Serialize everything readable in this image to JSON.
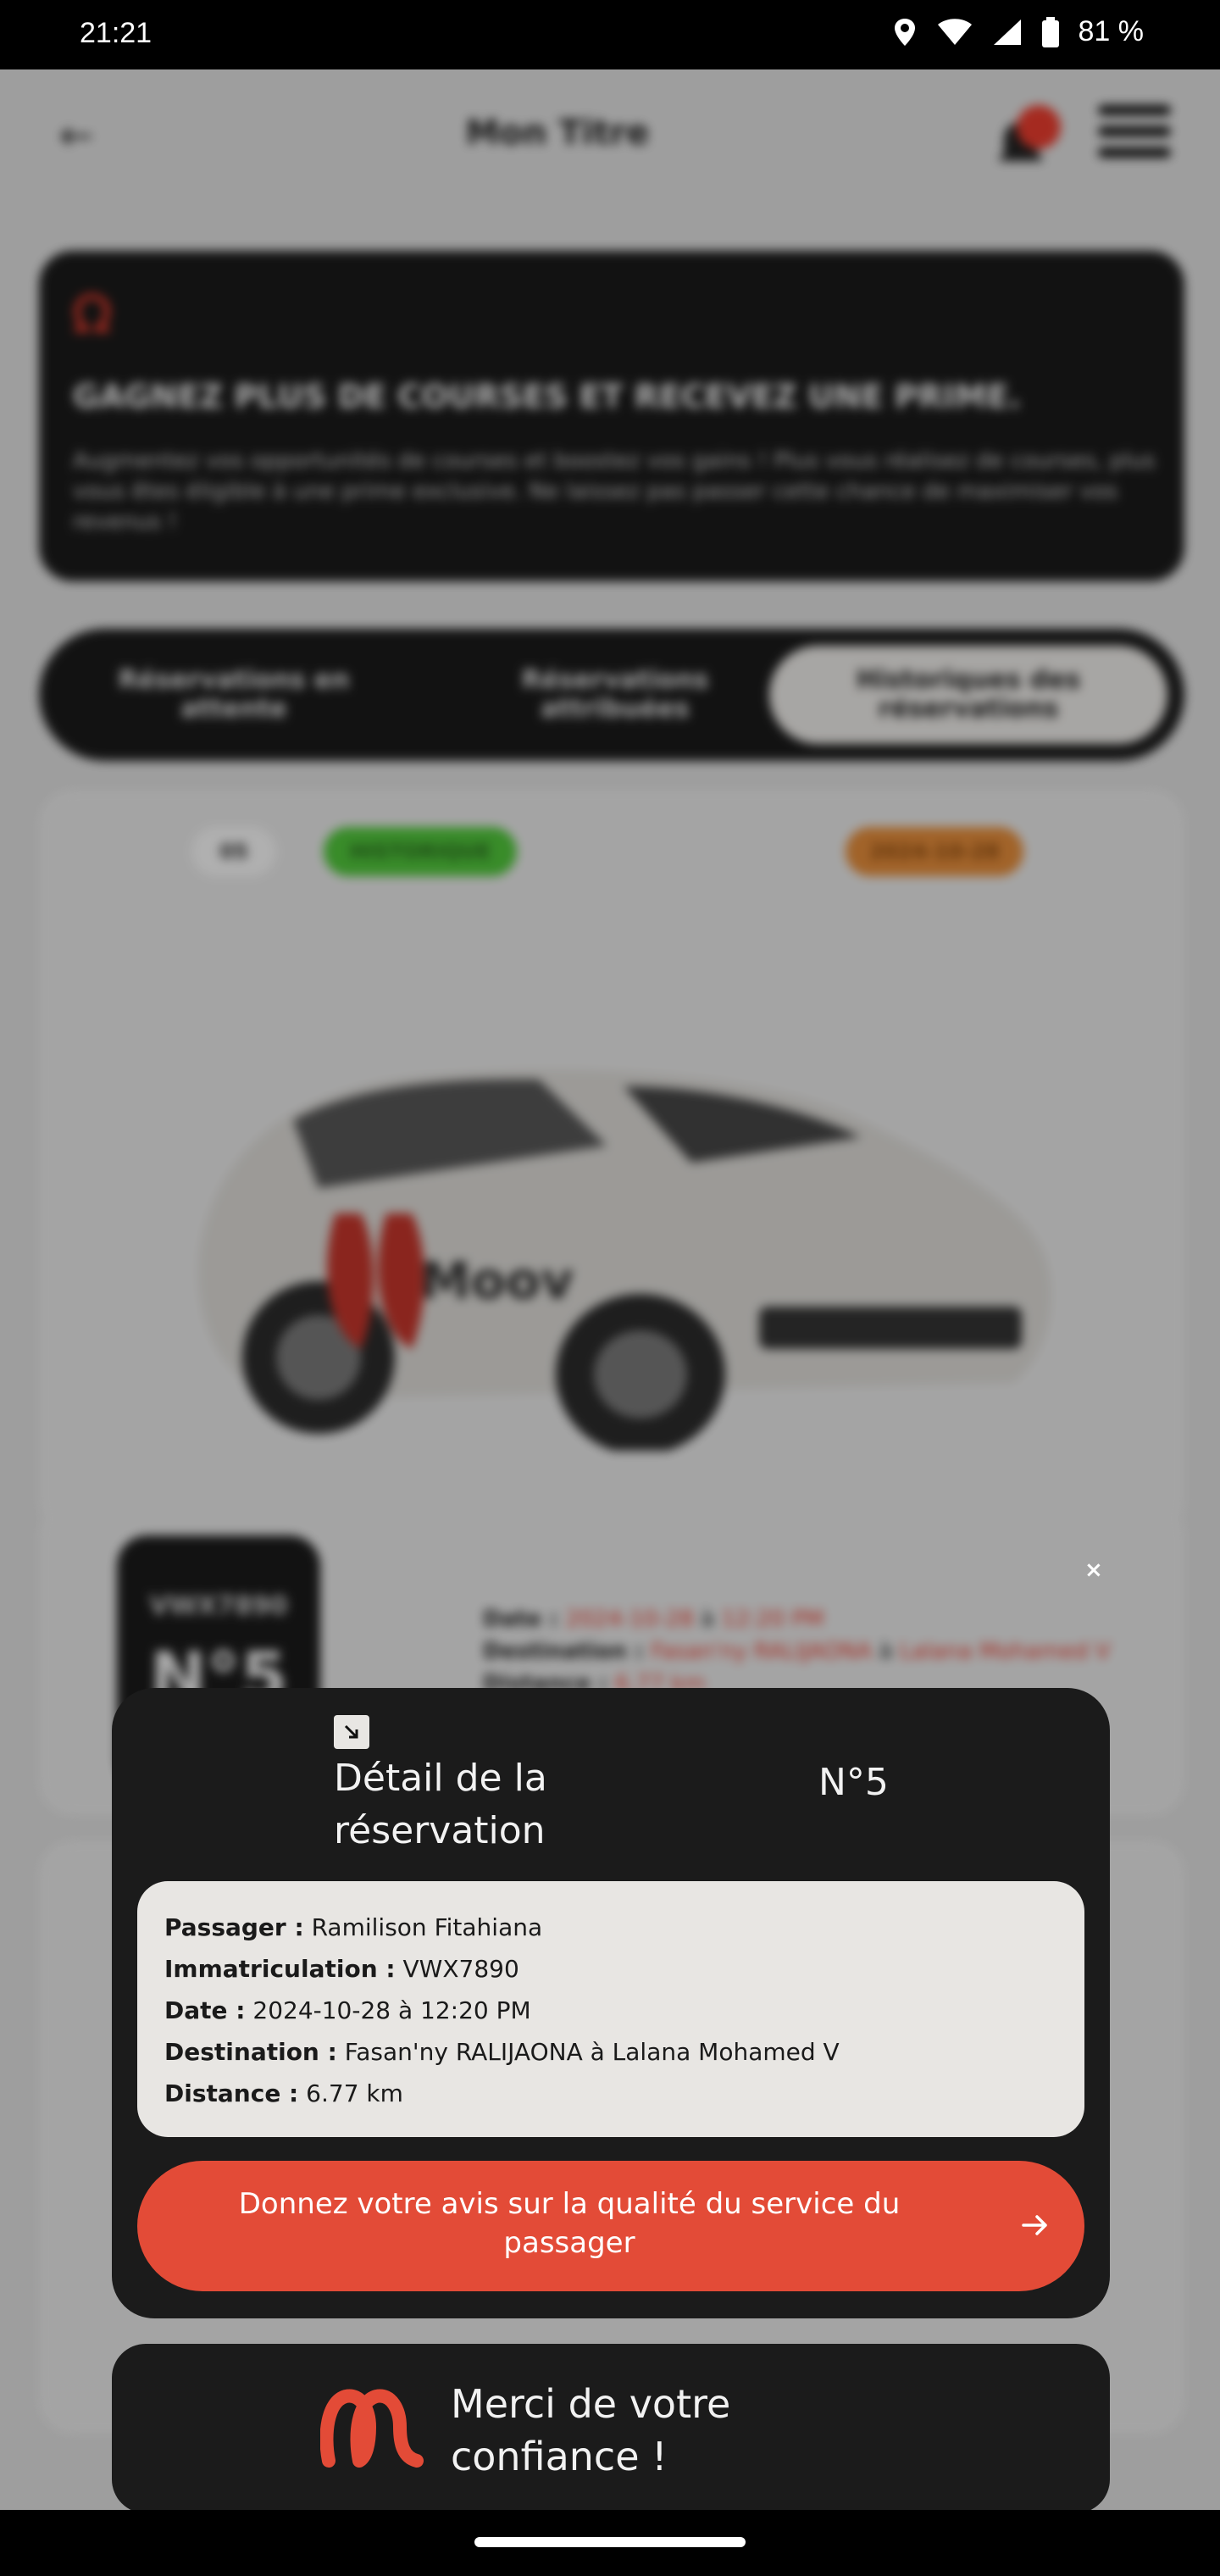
{
  "status_bar": {
    "time": "21:21",
    "battery": "81 %"
  },
  "background": {
    "title": "Mon Titre",
    "promo_title": "GAGNEZ PLUS DE COURSES ET RECEVEZ UNE PRIME.",
    "promo_text": "Augmentez vos opportunités de courses et boostez vos gains ! Plus vous réalisez de courses, plus vous êtes éligible à une prime exclusive. Ne laissez pas passer cette chance de maximiser vos revenus !",
    "tabs": [
      "Réservations en attente",
      "Réservations attribuées",
      "Historiques des réservations"
    ],
    "pill_small": "05",
    "pill_green": "HISTORIQUE",
    "pill_orange": "2024-10-28",
    "plate": "VWX7890",
    "number": "N°5",
    "info_date_label": "Date : ",
    "info_date": "2024-10-28",
    "info_at": " à ",
    "info_time": "12:20 PM",
    "info_dest_label": "Destination : ",
    "info_dest_from": "Fasan'ny RALIJAONA",
    "info_dest_to": "Lalana Mohamed V",
    "info_dist_label": "Distance : ",
    "info_dist": "6.77 km",
    "car_brand": "Moov"
  },
  "modal": {
    "title": "Détail de la réservation",
    "number": "N°5",
    "close": "×",
    "details": [
      {
        "label": "Passager :",
        "value": "Ramilison Fitahiana"
      },
      {
        "label": "Immatriculation :",
        "value": "VWX7890"
      },
      {
        "label": "Date :",
        "value": "2024-10-28 à 12:20 PM"
      },
      {
        "label": "Destination :",
        "value": "Fasan'ny RALIJAONA à Lalana Mohamed V"
      },
      {
        "label": "Distance :",
        "value": "6.77 km"
      }
    ],
    "rate_button": "Donnez votre avis sur la qualité du service du passager"
  },
  "thanks": {
    "text": "Merci de votre confiance !"
  },
  "colors": {
    "accent": "#e34b37",
    "dark": "#1b1b1b",
    "light": "#e8e6e3"
  }
}
